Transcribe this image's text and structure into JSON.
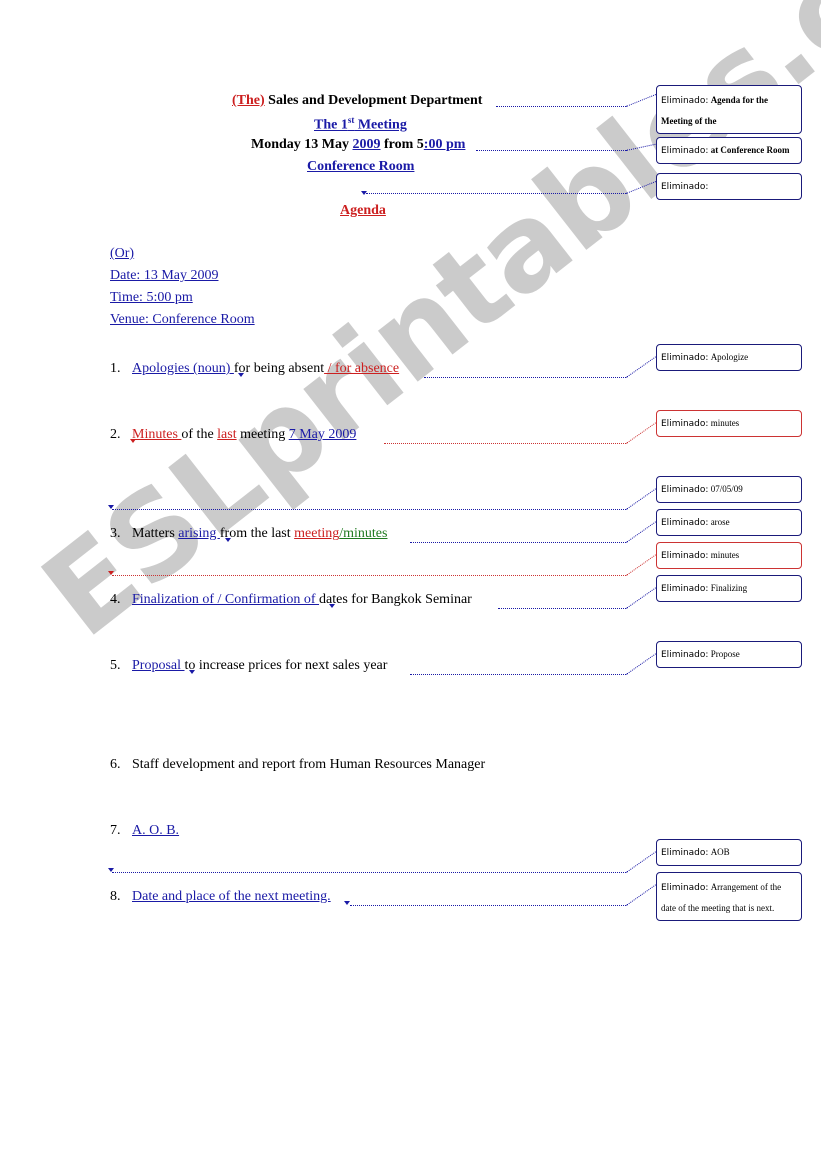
{
  "header": {
    "line1_prefix": "(The)",
    "line1_text": "Sales and Development Department",
    "line2_text": "The 1",
    "line2_sup": "st",
    "line2_rest": " Meeting",
    "line3_a": "Monday 13 May ",
    "line3_b": "2009",
    "line3_c": " from 5",
    "line3_d": ":00 pm",
    "line4": "Conference Room",
    "agenda": "Agenda"
  },
  "alt_block": {
    "or": "(Or)",
    "date": "Date: 13 May 2009",
    "time": "Time: 5:00 pm",
    "venue": "Venue: Conference Room"
  },
  "items": [
    {
      "num": "1.",
      "parts": [
        "Apologies (noun) ",
        " for being absent",
        " / for absence"
      ]
    },
    {
      "num": "2.",
      "parts": [
        "Minutes ",
        " of the ",
        "last",
        " meeting  ",
        " 7 May 2009 "
      ]
    },
    {
      "num": "3.",
      "parts": [
        "Matters ",
        "arising ",
        " from the last ",
        "meeting",
        "/minutes"
      ]
    },
    {
      "num": "4.",
      "parts": [
        "Finalization of / Confirmation of ",
        " dates for Bangkok Seminar"
      ]
    },
    {
      "num": "5.",
      "parts": [
        "Proposal ",
        " to increase prices for next sales year"
      ]
    },
    {
      "num": "6.",
      "parts": [
        "Staff development and report from Human Resources Manager"
      ]
    },
    {
      "num": "7.",
      "parts": [
        "A. O. B. "
      ]
    },
    {
      "num": "8.",
      "parts": [
        "Date and place of the next meeting. "
      ]
    }
  ],
  "balloons": [
    {
      "label": "Eliminado:",
      "deleted": "Agenda for the",
      "deleted2": "Meeting of the",
      "color": "blue"
    },
    {
      "label": "Eliminado:",
      "deleted": "at Conference Room",
      "color": "blue"
    },
    {
      "label": "Eliminado:",
      "deleted": "",
      "color": "blue"
    },
    {
      "label": "Eliminado:",
      "deleted": "Apologize",
      "color": "blue"
    },
    {
      "label": "Eliminado:",
      "deleted": "minutes",
      "color": "red"
    },
    {
      "label": "Eliminado:",
      "deleted": "07/05/09",
      "color": "blue"
    },
    {
      "label": "Eliminado:",
      "deleted": "arose",
      "color": "blue"
    },
    {
      "label": "Eliminado:",
      "deleted": "minutes",
      "color": "red"
    },
    {
      "label": "Eliminado:",
      "deleted": "Finalizing",
      "color": "blue"
    },
    {
      "label": "Eliminado:",
      "deleted": "Propose",
      "color": "blue"
    },
    {
      "label": "Eliminado:",
      "deleted": "AOB",
      "color": "blue"
    },
    {
      "label": "Eliminado:",
      "deleted": "Arrangement of the",
      "deleted2": "date of the meeting that is next.",
      "color": "blue"
    }
  ],
  "watermark": "ESLprintables.com",
  "colors": {
    "insert_blue": "#1a1aa6",
    "insert_red": "#cc1f1f",
    "insert_green": "#1f7a1f"
  }
}
